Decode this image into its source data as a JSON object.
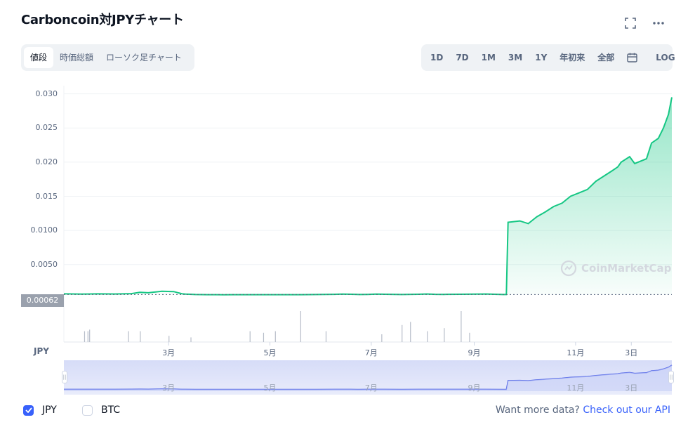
{
  "header": {
    "title": "Carboncoin対JPYチャート"
  },
  "tabs": [
    {
      "label": "値段",
      "active": true
    },
    {
      "label": "時価総額",
      "active": false
    },
    {
      "label": "ローソク足チャート",
      "active": false
    }
  ],
  "ranges": [
    "1D",
    "7D",
    "1M",
    "3M",
    "1Y",
    "年初来",
    "全部"
  ],
  "log_label": "LOG",
  "current_price": "0.00062",
  "axis_unit": "JPY",
  "watermark": "CoinMarketCap",
  "legend": [
    {
      "label": "JPY",
      "checked": true
    },
    {
      "label": "BTC",
      "checked": false
    }
  ],
  "footer": {
    "more_text": "Want more data?",
    "link_text": "Check out our API"
  },
  "colors": {
    "line": "#16c784",
    "area": "#16c784",
    "accent": "#3861fb",
    "navigator": "#5b6ee8"
  },
  "chart_data": {
    "type": "line",
    "y_ticks": [
      "0.030",
      "0.025",
      "0.020",
      "0.015",
      "0.0100",
      "0.0050"
    ],
    "ylim": [
      -0.0015,
      0.0312
    ],
    "x_ticks": [
      "3月",
      "5月",
      "7月",
      "9月",
      "11月",
      "3日"
    ],
    "x_tick_positions": [
      62,
      122,
      182,
      243,
      303,
      336
    ],
    "xlim": [
      0,
      360
    ],
    "series": [
      {
        "name": "JPY",
        "x": [
          0,
          10,
          20,
          30,
          40,
          45,
          50,
          58,
          65,
          70,
          72,
          78,
          85,
          90,
          95,
          100,
          110,
          120,
          130,
          140,
          150,
          160,
          165,
          170,
          175,
          180,
          185,
          190,
          200,
          210,
          215,
          220,
          225,
          235,
          245,
          250,
          260,
          262,
          263,
          270,
          275,
          280,
          285,
          290,
          295,
          300,
          305,
          310,
          315,
          320,
          325,
          328,
          330,
          335,
          338,
          340,
          345,
          348,
          352,
          355,
          358,
          360
        ],
        "y": [
          0.00072,
          0.00068,
          0.00072,
          0.0007,
          0.00075,
          0.00095,
          0.00088,
          0.0011,
          0.00105,
          0.00072,
          0.00068,
          0.00062,
          0.0006,
          0.0006,
          0.00058,
          0.0006,
          0.0006,
          0.0006,
          0.0006,
          0.0006,
          0.00062,
          0.00065,
          0.00068,
          0.00066,
          0.00062,
          0.00064,
          0.00068,
          0.00066,
          0.00062,
          0.00066,
          0.0007,
          0.00065,
          0.00064,
          0.00066,
          0.00068,
          0.0007,
          0.00062,
          0.00062,
          0.0112,
          0.0114,
          0.011,
          0.012,
          0.0127,
          0.0135,
          0.014,
          0.015,
          0.0155,
          0.016,
          0.0172,
          0.018,
          0.0188,
          0.0193,
          0.02,
          0.0208,
          0.0198,
          0.02,
          0.0205,
          0.0228,
          0.0235,
          0.025,
          0.027,
          0.0295
        ]
      }
    ],
    "volume": {
      "x": [
        12,
        14,
        15,
        38,
        45,
        62,
        75,
        110,
        118,
        125,
        140,
        155,
        188,
        200,
        205,
        215,
        225,
        235,
        240
      ],
      "v": [
        0.35,
        0.35,
        0.4,
        0.35,
        0.35,
        0.2,
        0.15,
        0.35,
        0.3,
        0.35,
        1.0,
        0.35,
        0.25,
        0.55,
        0.65,
        0.35,
        0.45,
        1.0,
        0.3
      ]
    }
  }
}
